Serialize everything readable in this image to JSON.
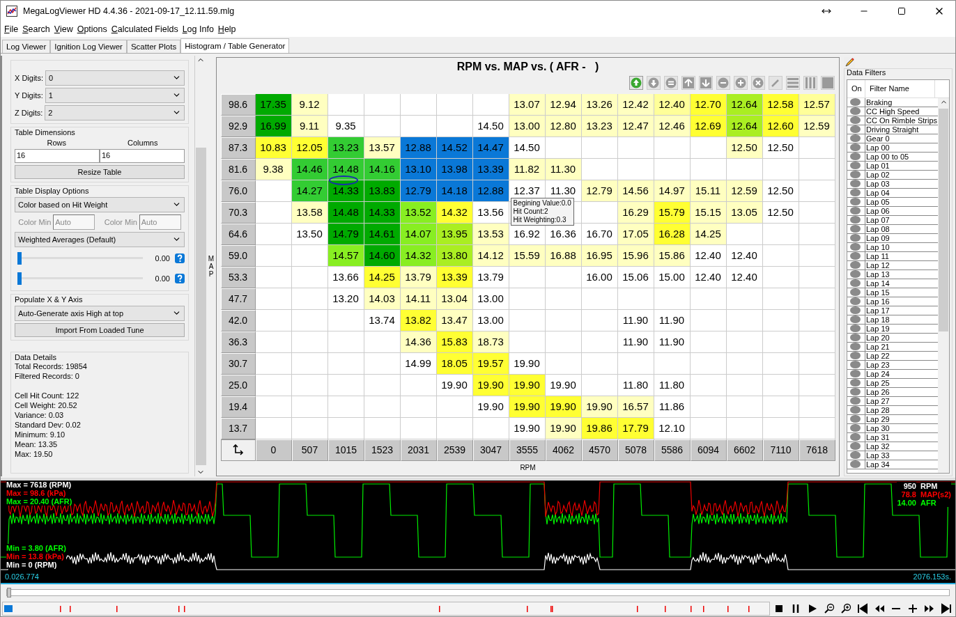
{
  "window": {
    "title": "MegaLogViewer HD 4.4.36 - 2021-09-17_12.11.59.mlg"
  },
  "menu": [
    "File",
    "Search",
    "View",
    "Options",
    "Calculated Fields",
    "Log Info",
    "Help"
  ],
  "tabs": [
    {
      "label": "Log Viewer",
      "selected": false
    },
    {
      "label": "Ignition Log Viewer",
      "selected": false
    },
    {
      "label": "Scatter Plots",
      "selected": false
    },
    {
      "label": "Histogram / Table Generator",
      "selected": true
    }
  ],
  "settings": {
    "digits": [
      {
        "label": "X Digits:",
        "value": "0"
      },
      {
        "label": "Y Digits:",
        "value": "1"
      },
      {
        "label": "Z Digits:",
        "value": "2"
      }
    ],
    "table_dimensions": {
      "title": "Table Dimensions",
      "rows_label": "Rows",
      "columns_label": "Columns",
      "rows": "16",
      "columns": "16",
      "button": "Resize Table"
    },
    "display_options": {
      "title": "Table Display Options",
      "color_mode": "Color based on Hit Weight",
      "color_fields": [
        {
          "label": "Color Min",
          "placeholder": "Auto"
        },
        {
          "label": "Color Min",
          "placeholder": "Auto"
        }
      ],
      "averaging": "Weighted Averages (Default)",
      "sliders": [
        {
          "level": 0,
          "reading": "0.00"
        },
        {
          "level": 0,
          "reading": "0.00"
        }
      ]
    },
    "populate": {
      "title": "Populate X & Y Axis",
      "mode": "Auto-Generate axis High at top",
      "button": "Import From Loaded Tune"
    },
    "details": {
      "title": "Data Details",
      "groups": [
        [
          "Total Records: 19854",
          "Filtered Records: 0"
        ],
        [
          "Cell Hit Count: 122",
          "Cell Weight: 20.52",
          "Variance: 0.03",
          "Standard Dev: 0.02",
          "Minimum: 9.10",
          "Mean: 13.35",
          "Max: 19.50"
        ]
      ]
    }
  },
  "table": {
    "title": "RPM vs. MAP vs. ( AFR -   )",
    "y_axis_label": "MAP",
    "x_axis_label": "RPM",
    "toolbar": [
      {
        "kind": "up-circle",
        "disabled": false
      },
      {
        "kind": "down-circle",
        "disabled": true
      },
      {
        "kind": "equals",
        "disabled": true
      },
      {
        "kind": "up-square",
        "disabled": true
      },
      {
        "kind": "down-square",
        "disabled": true
      },
      {
        "kind": "minus",
        "disabled": true
      },
      {
        "kind": "plus",
        "disabled": true
      },
      {
        "kind": "cross",
        "disabled": true
      },
      {
        "kind": "pencil",
        "disabled": true
      },
      {
        "kind": "rows",
        "disabled": true
      },
      {
        "kind": "columns",
        "disabled": true
      },
      {
        "kind": "fill",
        "disabled": true
      }
    ],
    "rows": [
      {
        "label": "98.6",
        "cells": [
          {
            "value": "17.35",
            "color": "#00aa00"
          },
          {
            "value": "9.12",
            "color": "#ffffc0"
          },
          null,
          null,
          null,
          null,
          null,
          {
            "value": "13.07",
            "color": "#ffffc0"
          },
          {
            "value": "12.94",
            "color": "#ffffc0"
          },
          {
            "value": "13.26",
            "color": "#ffffc0"
          },
          {
            "value": "12.42",
            "color": "#ffffc0"
          },
          {
            "value": "12.40",
            "color": "#ffff99"
          },
          {
            "value": "12.70",
            "color": "#ffff33"
          },
          {
            "value": "12.64",
            "color": "#aaee22"
          },
          {
            "value": "12.58",
            "color": "#ffff33"
          },
          {
            "value": "12.57",
            "color": "#ffff99"
          }
        ]
      },
      {
        "label": "92.9",
        "cells": [
          {
            "value": "16.99",
            "color": "#00aa00"
          },
          {
            "value": "9.11",
            "color": "#ffffc0"
          },
          {
            "value": "9.35",
            "color": "#ffffff"
          },
          null,
          null,
          null,
          {
            "value": "14.50",
            "color": "#ffffff"
          },
          {
            "value": "13.00",
            "color": "#ffffc0"
          },
          {
            "value": "12.80",
            "color": "#ffffc0"
          },
          {
            "value": "13.23",
            "color": "#ffffc0"
          },
          {
            "value": "12.47",
            "color": "#ffffc0"
          },
          {
            "value": "12.46",
            "color": "#ffffc0"
          },
          {
            "value": "12.69",
            "color": "#ffff33"
          },
          {
            "value": "12.64",
            "color": "#aaee22"
          },
          {
            "value": "12.60",
            "color": "#ffff33"
          },
          {
            "value": "12.59",
            "color": "#ffffc0"
          }
        ]
      },
      {
        "label": "87.3",
        "cells": [
          {
            "value": "10.83",
            "color": "#ffff33"
          },
          {
            "value": "12.05",
            "color": "#ffff33"
          },
          {
            "value": "13.23",
            "color": "#33cc33"
          },
          {
            "value": "13.57",
            "color": "#ffffc0"
          },
          {
            "value": "12.88",
            "color": "#0a78d7"
          },
          {
            "value": "14.52",
            "color": "#0a78d7"
          },
          {
            "value": "14.47",
            "color": "#0a78d7"
          },
          {
            "value": "14.50",
            "color": "#ffffff"
          },
          null,
          null,
          null,
          null,
          null,
          {
            "value": "12.50",
            "color": "#ffffc0"
          },
          {
            "value": "12.50",
            "color": "#ffffff"
          },
          null
        ]
      },
      {
        "label": "81.6",
        "cells": [
          {
            "value": "9.38",
            "color": "#ffffc0"
          },
          {
            "value": "14.46",
            "color": "#33cc33"
          },
          {
            "value": "14.48",
            "color": "#33cc33"
          },
          {
            "value": "14.16",
            "color": "#33cc33"
          },
          {
            "value": "13.10",
            "color": "#0a78d7"
          },
          {
            "value": "13.98",
            "color": "#0a78d7"
          },
          {
            "value": "13.39",
            "color": "#0a78d7"
          },
          {
            "value": "11.82",
            "color": "#ffffc0"
          },
          {
            "value": "11.30",
            "color": "#ffffc0"
          },
          null,
          null,
          null,
          null,
          null,
          null,
          null
        ]
      },
      {
        "label": "76.0",
        "cells": [
          null,
          {
            "value": "14.27",
            "color": "#33cc33"
          },
          {
            "value": "14.33",
            "color": "#00aa00"
          },
          {
            "value": "13.83",
            "color": "#00aa00"
          },
          {
            "value": "12.79",
            "color": "#0a78d7"
          },
          {
            "value": "14.18",
            "color": "#0a78d7"
          },
          {
            "value": "12.88",
            "color": "#0a78d7"
          },
          {
            "value": "12.37",
            "color": "#ffffff"
          },
          {
            "value": "11.30",
            "color": "#ffffff"
          },
          {
            "value": "12.79",
            "color": "#ffffc0"
          },
          {
            "value": "14.56",
            "color": "#ffffc0"
          },
          {
            "value": "14.97",
            "color": "#ffffc0"
          },
          {
            "value": "15.11",
            "color": "#ffffc0"
          },
          {
            "value": "12.59",
            "color": "#ffffc0"
          },
          {
            "value": "12.50",
            "color": "#ffffff"
          },
          null
        ]
      },
      {
        "label": "70.3",
        "cells": [
          null,
          {
            "value": "13.58",
            "color": "#ffffc0"
          },
          {
            "value": "14.48",
            "color": "#00aa00"
          },
          {
            "value": "14.33",
            "color": "#00aa00"
          },
          {
            "value": "13.52",
            "color": "#88ee22"
          },
          {
            "value": "14.32",
            "color": "#ffff33"
          },
          {
            "value": "13.56",
            "color": "#ffffff"
          },
          null,
          null,
          null,
          {
            "value": "16.29",
            "color": "#ffffc0"
          },
          {
            "value": "15.79",
            "color": "#ffff33"
          },
          {
            "value": "15.15",
            "color": "#ffffc0"
          },
          {
            "value": "13.05",
            "color": "#ffffc0"
          },
          {
            "value": "12.50",
            "color": "#ffffff"
          },
          null
        ]
      },
      {
        "label": "64.6",
        "cells": [
          null,
          {
            "value": "13.50",
            "color": "#ffffff"
          },
          {
            "value": "14.79",
            "color": "#00aa00"
          },
          {
            "value": "14.61",
            "color": "#00aa00"
          },
          {
            "value": "14.07",
            "color": "#88ee22"
          },
          {
            "value": "13.95",
            "color": "#aaee22"
          },
          {
            "value": "13.53",
            "color": "#ffffc0"
          },
          {
            "value": "16.92",
            "color": "#ffffff"
          },
          {
            "value": "16.36",
            "color": "#ffffff"
          },
          {
            "value": "16.70",
            "color": "#ffffff"
          },
          {
            "value": "17.05",
            "color": "#ffffc0"
          },
          {
            "value": "16.28",
            "color": "#ffff33"
          },
          {
            "value": "14.25",
            "color": "#ffffc0"
          },
          null,
          null,
          null
        ]
      },
      {
        "label": "59.0",
        "cells": [
          null,
          null,
          {
            "value": "14.57",
            "color": "#88ee22"
          },
          {
            "value": "14.60",
            "color": "#00aa00"
          },
          {
            "value": "14.32",
            "color": "#88ee22"
          },
          {
            "value": "13.80",
            "color": "#aaee22"
          },
          {
            "value": "14.12",
            "color": "#ffffc0"
          },
          {
            "value": "15.59",
            "color": "#ffffc0"
          },
          {
            "value": "16.88",
            "color": "#ffffc0"
          },
          {
            "value": "16.95",
            "color": "#ffffc0"
          },
          {
            "value": "15.96",
            "color": "#ffffc0"
          },
          {
            "value": "15.86",
            "color": "#ffffc0"
          },
          {
            "value": "12.40",
            "color": "#ffffff"
          },
          {
            "value": "12.40",
            "color": "#ffffff"
          },
          null,
          null
        ]
      },
      {
        "label": "53.3",
        "cells": [
          null,
          null,
          {
            "value": "13.66",
            "color": "#ffffff"
          },
          {
            "value": "14.25",
            "color": "#ffff33"
          },
          {
            "value": "13.79",
            "color": "#ffffc0"
          },
          {
            "value": "13.39",
            "color": "#ffff33"
          },
          {
            "value": "13.79",
            "color": "#ffffff"
          },
          null,
          null,
          {
            "value": "16.00",
            "color": "#ffffff"
          },
          {
            "value": "15.06",
            "color": "#ffffff"
          },
          {
            "value": "15.00",
            "color": "#ffffff"
          },
          {
            "value": "12.40",
            "color": "#ffffff"
          },
          {
            "value": "12.40",
            "color": "#ffffff"
          },
          null,
          null
        ]
      },
      {
        "label": "47.7",
        "cells": [
          null,
          null,
          {
            "value": "13.20",
            "color": "#ffffff"
          },
          {
            "value": "14.03",
            "color": "#ffffc0"
          },
          {
            "value": "14.11",
            "color": "#ffffc0"
          },
          {
            "value": "13.04",
            "color": "#ffffc0"
          },
          {
            "value": "13.00",
            "color": "#ffffff"
          },
          null,
          null,
          null,
          null,
          null,
          null,
          null,
          null,
          null
        ]
      },
      {
        "label": "42.0",
        "cells": [
          null,
          null,
          null,
          {
            "value": "13.74",
            "color": "#ffffff"
          },
          {
            "value": "13.82",
            "color": "#ffff33"
          },
          {
            "value": "13.47",
            "color": "#ffffc0"
          },
          {
            "value": "13.00",
            "color": "#ffffff"
          },
          null,
          null,
          null,
          {
            "value": "11.90",
            "color": "#ffffff"
          },
          {
            "value": "11.90",
            "color": "#ffffff"
          },
          null,
          null,
          null,
          null
        ]
      },
      {
        "label": "36.3",
        "cells": [
          null,
          null,
          null,
          null,
          {
            "value": "14.36",
            "color": "#ffffc0"
          },
          {
            "value": "15.83",
            "color": "#ffff33"
          },
          {
            "value": "18.73",
            "color": "#ffffc0"
          },
          null,
          null,
          null,
          {
            "value": "11.90",
            "color": "#ffffff"
          },
          {
            "value": "11.90",
            "color": "#ffffff"
          },
          null,
          null,
          null,
          null
        ]
      },
      {
        "label": "30.7",
        "cells": [
          null,
          null,
          null,
          null,
          {
            "value": "14.99",
            "color": "#ffffff"
          },
          {
            "value": "18.05",
            "color": "#ffff33"
          },
          {
            "value": "19.57",
            "color": "#ffff33"
          },
          {
            "value": "19.90",
            "color": "#ffffff"
          },
          null,
          null,
          null,
          null,
          null,
          null,
          null,
          null
        ]
      },
      {
        "label": "25.0",
        "cells": [
          null,
          null,
          null,
          null,
          null,
          {
            "value": "19.90",
            "color": "#ffffff"
          },
          {
            "value": "19.90",
            "color": "#ffff33"
          },
          {
            "value": "19.90",
            "color": "#ffff33"
          },
          {
            "value": "19.90",
            "color": "#ffffff"
          },
          null,
          {
            "value": "11.80",
            "color": "#ffffff"
          },
          {
            "value": "11.80",
            "color": "#ffffff"
          },
          null,
          null,
          null,
          null
        ]
      },
      {
        "label": "19.4",
        "cells": [
          null,
          null,
          null,
          null,
          null,
          null,
          {
            "value": "19.90",
            "color": "#ffffff"
          },
          {
            "value": "19.90",
            "color": "#ffff33"
          },
          {
            "value": "19.90",
            "color": "#ffff33"
          },
          {
            "value": "19.90",
            "color": "#ffffc0"
          },
          {
            "value": "16.57",
            "color": "#ffffc0"
          },
          {
            "value": "11.86",
            "color": "#ffffff"
          },
          null,
          null,
          null,
          null
        ]
      },
      {
        "label": "13.7",
        "cells": [
          null,
          null,
          null,
          null,
          null,
          null,
          null,
          {
            "value": "19.90",
            "color": "#ffffff"
          },
          {
            "value": "19.90",
            "color": "#ffffc0"
          },
          {
            "value": "19.86",
            "color": "#ffff33"
          },
          {
            "value": "17.79",
            "color": "#ffff33"
          },
          {
            "value": "12.10",
            "color": "#ffffff"
          },
          null,
          null,
          null,
          null
        ]
      }
    ],
    "x_headers": [
      "0",
      "507",
      "1015",
      "1523",
      "2031",
      "2539",
      "3047",
      "3555",
      "4062",
      "4570",
      "5078",
      "5586",
      "6094",
      "6602",
      "7110",
      "7618"
    ],
    "tooltip": [
      "Begining Value:0.0",
      "Hit Count:2",
      "Hit Weighting:0.3"
    ]
  },
  "filters": {
    "title": "Data Filters",
    "columns": [
      "On",
      "Filter Name"
    ],
    "items": [
      {
        "name": "Braking",
        "on": false
      },
      {
        "name": "CC High Speed",
        "on": false
      },
      {
        "name": "CC On Rimble Strips",
        "on": false
      },
      {
        "name": "Driving Straight",
        "on": false
      },
      {
        "name": "Gear 0",
        "on": false
      },
      {
        "name": "Lap 00",
        "on": false
      },
      {
        "name": "Lap 00 to 05",
        "on": false
      },
      {
        "name": "Lap 01",
        "on": false
      },
      {
        "name": "Lap 02",
        "on": false
      },
      {
        "name": "Lap 03",
        "on": false
      },
      {
        "name": "Lap 04",
        "on": false
      },
      {
        "name": "Lap 05",
        "on": false
      },
      {
        "name": "Lap 06",
        "on": false
      },
      {
        "name": "Lap 07",
        "on": false
      },
      {
        "name": "Lap 08",
        "on": false
      },
      {
        "name": "Lap 09",
        "on": false
      },
      {
        "name": "Lap 10",
        "on": false
      },
      {
        "name": "Lap 11",
        "on": false
      },
      {
        "name": "Lap 12",
        "on": false
      },
      {
        "name": "Lap 13",
        "on": false
      },
      {
        "name": "Lap 14",
        "on": false
      },
      {
        "name": "Lap 15",
        "on": false
      },
      {
        "name": "Lap 16",
        "on": false
      },
      {
        "name": "Lap 17",
        "on": false
      },
      {
        "name": "Lap 18",
        "on": false
      },
      {
        "name": "Lap 19",
        "on": false
      },
      {
        "name": "Lap 20",
        "on": false
      },
      {
        "name": "Lap 21",
        "on": false
      },
      {
        "name": "Lap 22",
        "on": false
      },
      {
        "name": "Lap 23",
        "on": false
      },
      {
        "name": "Lap 24",
        "on": false
      },
      {
        "name": "Lap 25",
        "on": false
      },
      {
        "name": "Lap 26",
        "on": false
      },
      {
        "name": "Lap 27",
        "on": false
      },
      {
        "name": "Lap 28",
        "on": false
      },
      {
        "name": "Lap 29",
        "on": false
      },
      {
        "name": "Lap 30",
        "on": false
      },
      {
        "name": "Lap 31",
        "on": false
      },
      {
        "name": "Lap 32",
        "on": false
      },
      {
        "name": "Lap 33",
        "on": false
      },
      {
        "name": "Lap 34",
        "on": false
      }
    ]
  },
  "log_chart": {
    "max_labels": [
      {
        "text": "Max = 7618 (RPM)",
        "color": "#ffffff"
      },
      {
        "text": "Max = 98.6 (kPa)",
        "color": "#ff0000"
      },
      {
        "text": "Max = 20.40 (AFR)",
        "color": "#00ff00"
      }
    ],
    "min_labels": [
      {
        "text": "Min = 3.80 (AFR)",
        "color": "#00ff00"
      },
      {
        "text": "Min = 13.8 (kPa)",
        "color": "#ff0000"
      },
      {
        "text": "Min = 0 (RPM)",
        "color": "#ffffff"
      }
    ],
    "readouts": [
      {
        "value": "950",
        "name": "RPM",
        "color": "#ffffff"
      },
      {
        "value": "78.8",
        "name": "MAP(s2)",
        "color": "#ff0000"
      },
      {
        "value": "14.00",
        "name": "AFR",
        "color": "#00ff00"
      }
    ],
    "start_time": "0.026.774",
    "end_time": "2076.153s.",
    "position_slider": {
      "level": 0
    }
  }
}
